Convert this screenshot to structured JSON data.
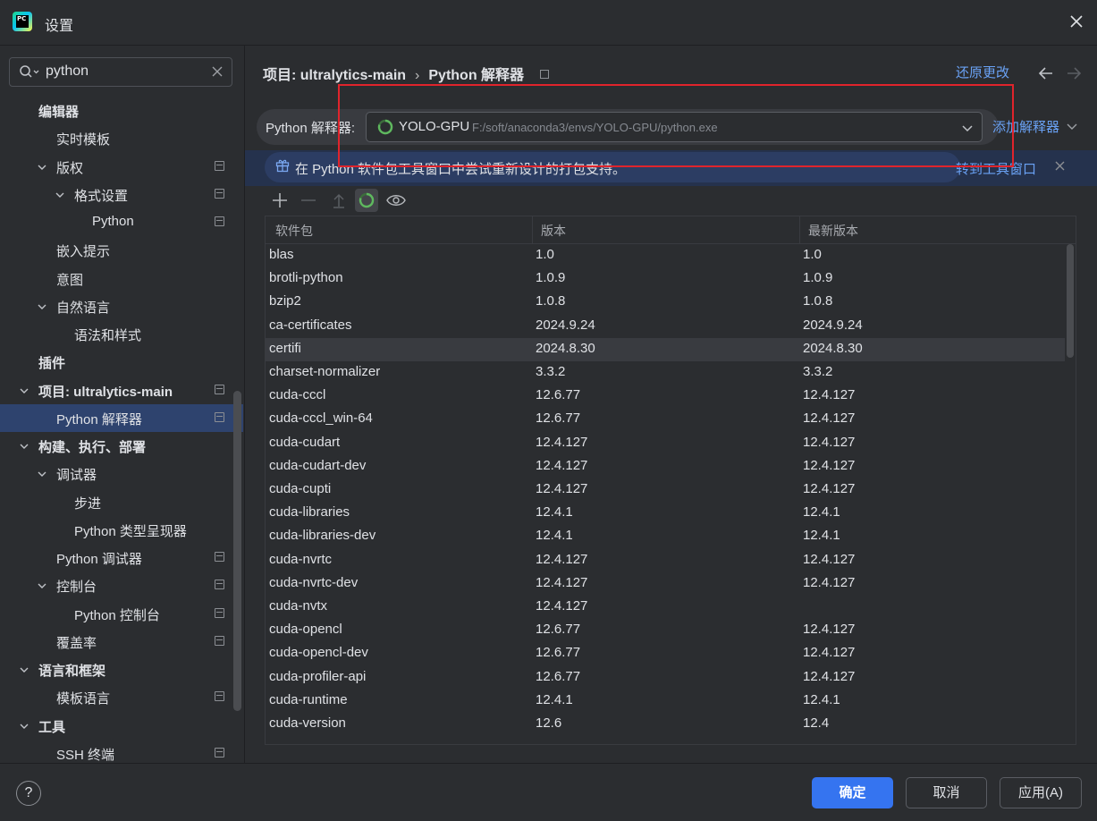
{
  "window": {
    "title": "设置"
  },
  "search": {
    "value": "python"
  },
  "sidebar": {
    "items": [
      {
        "label": "编辑器",
        "bold": true,
        "expandable": false
      },
      {
        "label": "实时模板",
        "bold": false,
        "expandable": false
      },
      {
        "label": "版权",
        "bold": false,
        "expandable": true,
        "page_icon": true
      },
      {
        "label": "格式设置",
        "bold": false,
        "expandable": true,
        "page_icon": true
      },
      {
        "label": "Python",
        "bold": false,
        "expandable": false,
        "page_icon": true
      },
      {
        "label": "嵌入提示",
        "bold": false,
        "expandable": false
      },
      {
        "label": "意图",
        "bold": false,
        "expandable": false
      },
      {
        "label": "自然语言",
        "bold": false,
        "expandable": true
      },
      {
        "label": "语法和样式",
        "bold": false,
        "expandable": false
      },
      {
        "label": "插件",
        "bold": true,
        "expandable": false
      },
      {
        "label": "项目: ultralytics-main",
        "bold": true,
        "expandable": true,
        "page_icon": true
      },
      {
        "label": "Python 解释器",
        "bold": false,
        "expandable": false,
        "page_icon": true,
        "selected": true
      },
      {
        "label": "构建、执行、部署",
        "bold": true,
        "expandable": true
      },
      {
        "label": "调试器",
        "bold": false,
        "expandable": true
      },
      {
        "label": "步进",
        "bold": false,
        "expandable": false
      },
      {
        "label": "Python 类型呈现器",
        "bold": false,
        "expandable": false
      },
      {
        "label": "Python 调试器",
        "bold": false,
        "expandable": false,
        "page_icon": true
      },
      {
        "label": "控制台",
        "bold": false,
        "expandable": true,
        "page_icon": true
      },
      {
        "label": "Python 控制台",
        "bold": false,
        "expandable": false,
        "page_icon": true
      },
      {
        "label": "覆盖率",
        "bold": false,
        "expandable": false,
        "page_icon": true
      },
      {
        "label": "语言和框架",
        "bold": true,
        "expandable": true
      },
      {
        "label": "模板语言",
        "bold": false,
        "expandable": false,
        "page_icon": true
      },
      {
        "label": "工具",
        "bold": true,
        "expandable": true
      },
      {
        "label": "SSH 终端",
        "bold": false,
        "expandable": false,
        "page_icon": true
      }
    ]
  },
  "breadcrumb": {
    "project": "项目: ultralytics-main",
    "sep": "›",
    "page": "Python 解释器"
  },
  "header": {
    "reset_label": "还原更改"
  },
  "interpreter": {
    "label": "Python 解释器:",
    "name": "YOLO-GPU",
    "path": "F:/soft/anaconda3/envs/YOLO-GPU/python.exe",
    "add_label": "添加解释器"
  },
  "banner": {
    "text": "在 Python 软件包工具窗口中尝试重新设计的打包支持。",
    "link": "转到工具窗口"
  },
  "table": {
    "columns": [
      "软件包",
      "版本",
      "最新版本"
    ],
    "rows": [
      [
        "blas",
        "1.0",
        "1.0"
      ],
      [
        "brotli-python",
        "1.0.9",
        "1.0.9"
      ],
      [
        "bzip2",
        "1.0.8",
        "1.0.8"
      ],
      [
        "ca-certificates",
        "2024.9.24",
        "2024.9.24"
      ],
      [
        "certifi",
        "2024.8.30",
        "2024.8.30"
      ],
      [
        "charset-normalizer",
        "3.3.2",
        "3.3.2"
      ],
      [
        "cuda-cccl",
        "12.6.77",
        "12.4.127"
      ],
      [
        "cuda-cccl_win-64",
        "12.6.77",
        "12.4.127"
      ],
      [
        "cuda-cudart",
        "12.4.127",
        "12.4.127"
      ],
      [
        "cuda-cudart-dev",
        "12.4.127",
        "12.4.127"
      ],
      [
        "cuda-cupti",
        "12.4.127",
        "12.4.127"
      ],
      [
        "cuda-libraries",
        "12.4.1",
        "12.4.1"
      ],
      [
        "cuda-libraries-dev",
        "12.4.1",
        "12.4.1"
      ],
      [
        "cuda-nvrtc",
        "12.4.127",
        "12.4.127"
      ],
      [
        "cuda-nvrtc-dev",
        "12.4.127",
        "12.4.127"
      ],
      [
        "cuda-nvtx",
        "12.4.127",
        ""
      ],
      [
        "cuda-opencl",
        "12.6.77",
        "12.4.127"
      ],
      [
        "cuda-opencl-dev",
        "12.6.77",
        "12.4.127"
      ],
      [
        "cuda-profiler-api",
        "12.6.77",
        "12.4.127"
      ],
      [
        "cuda-runtime",
        "12.4.1",
        "12.4.1"
      ],
      [
        "cuda-version",
        "12.6",
        "12.4"
      ]
    ],
    "highlighted_row": 4
  },
  "footer": {
    "help": "?",
    "ok": "确定",
    "cancel": "取消",
    "apply": "应用(A)"
  },
  "colors": {
    "accent": "#3574f0",
    "link": "#6aa2f5",
    "annotation_box": "#e0242c",
    "selection": "#2e436e"
  }
}
